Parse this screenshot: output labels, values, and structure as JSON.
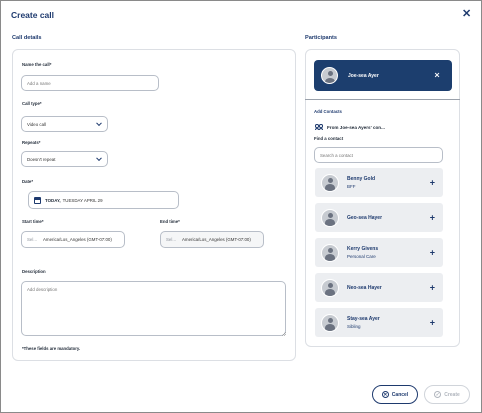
{
  "dialog": {
    "title": "Create call",
    "close_icon": "close-icon"
  },
  "call_details": {
    "heading": "Call details",
    "name": {
      "label": "Name the call*",
      "placeholder": "Add a name",
      "value": ""
    },
    "call_type": {
      "label": "Call type*",
      "value": "Video call"
    },
    "repeats": {
      "label": "Repeats*",
      "value": "Doesn't repeat"
    },
    "date": {
      "label": "Date*",
      "day_label": "TODAY,",
      "date_value": "TUESDAY APRIL 29"
    },
    "start_time": {
      "label": "Start time*",
      "placeholder": "Sel...",
      "timezone": "America/Los_Angeles (GMT-07:00)"
    },
    "end_time": {
      "label": "End time*",
      "placeholder": "Sel...",
      "timezone": "America/Los_Angeles (GMT-07:00)"
    },
    "description": {
      "label": "Description",
      "placeholder": "Add description"
    },
    "mandatory_note": "*These fields are mandatory."
  },
  "participants": {
    "heading": "Participants",
    "selected": [
      {
        "name": "Joe-sea Ayer"
      }
    ],
    "add_contacts_label": "Add Contacts",
    "from_label": "From Joe-sea Ayers' con...",
    "find_label": "Find a contact",
    "search_placeholder": "Search a contact",
    "contacts": [
      {
        "name": "Benny Gold",
        "relation": "BFF"
      },
      {
        "name": "Geo-sea Hayer",
        "relation": ""
      },
      {
        "name": "Kerry Givens",
        "relation": "Personal Care"
      },
      {
        "name": "Neo-sea Hayer",
        "relation": ""
      },
      {
        "name": "Stay-sea Ayer",
        "relation": "Sibling"
      }
    ],
    "add_icon": "+"
  },
  "footer": {
    "cancel_label": "Cancel",
    "create_label": "Create"
  },
  "colors": {
    "primary": "#1e3a6e",
    "participant_bg": "#1c3e6e",
    "contact_bg": "#eceef1",
    "border": "#dcdfe4"
  }
}
